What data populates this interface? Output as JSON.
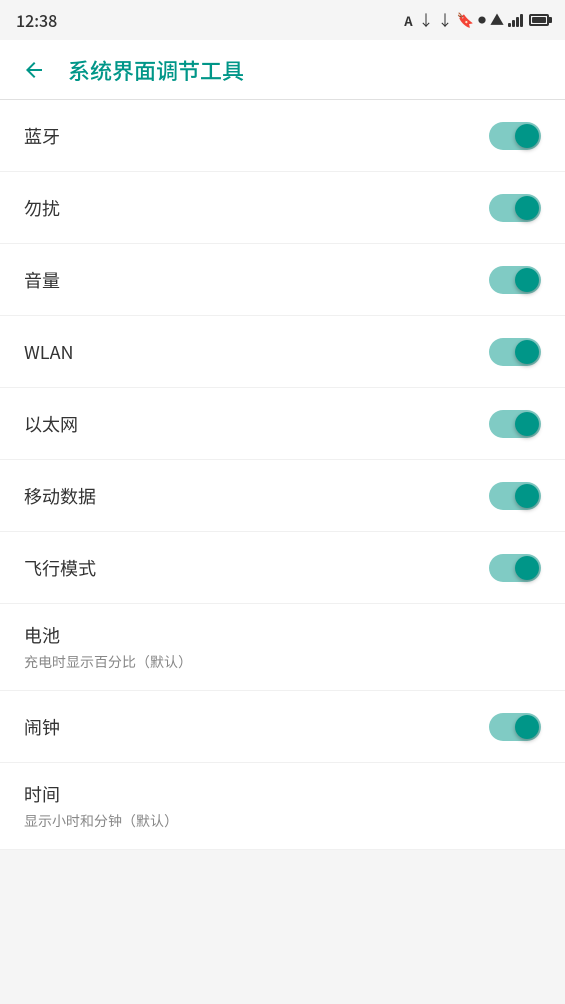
{
  "statusBar": {
    "time": "12:38",
    "icons": [
      "notification",
      "download",
      "download-alt",
      "bookmark",
      "dot"
    ]
  },
  "appBar": {
    "title": "系统界面调节工具",
    "backLabel": "←"
  },
  "settings": [
    {
      "id": "bluetooth",
      "label": "蓝牙",
      "sublabel": null,
      "toggled": true
    },
    {
      "id": "dnd",
      "label": "勿扰",
      "sublabel": null,
      "toggled": true
    },
    {
      "id": "volume",
      "label": "音量",
      "sublabel": null,
      "toggled": true
    },
    {
      "id": "wlan",
      "label": "WLAN",
      "sublabel": null,
      "toggled": true
    },
    {
      "id": "ethernet",
      "label": "以太网",
      "sublabel": null,
      "toggled": true
    },
    {
      "id": "mobile-data",
      "label": "移动数据",
      "sublabel": null,
      "toggled": true
    },
    {
      "id": "airplane-mode",
      "label": "飞行模式",
      "sublabel": null,
      "toggled": true
    },
    {
      "id": "battery",
      "label": "电池",
      "sublabel": "充电时显示百分比（默认）",
      "toggled": false
    },
    {
      "id": "alarm",
      "label": "闹钟",
      "sublabel": null,
      "toggled": true
    },
    {
      "id": "time",
      "label": "时间",
      "sublabel": "显示小时和分钟（默认）",
      "toggled": false
    }
  ],
  "colors": {
    "accent": "#009688",
    "toggleTrack": "#80cbc4",
    "toggleThumb": "#009688"
  }
}
